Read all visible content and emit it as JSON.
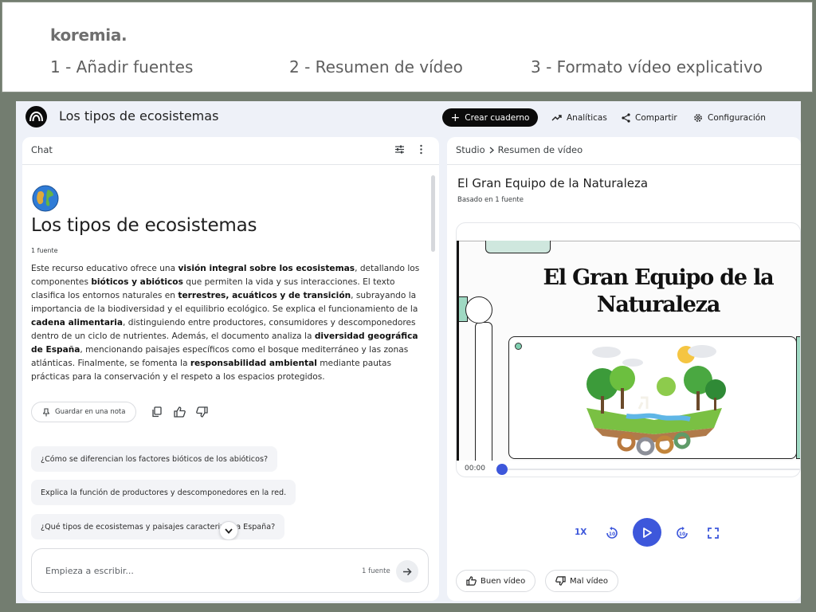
{
  "banner": {
    "brand": "koremia.",
    "steps": [
      "1 - Añadir fuentes",
      "2 - Resumen de vídeo",
      "3 - Formato vídeo explicativo"
    ]
  },
  "app": {
    "notebook_title": "Los tipos de ecosistemas",
    "toolbar": {
      "create": "Crear cuaderno",
      "analytics": "Analíticas",
      "share": "Compartir",
      "settings": "Configuración"
    },
    "icons": [
      "notebooklm-logo-icon",
      "plus-icon",
      "trending-up-icon",
      "share-icon",
      "gear-icon",
      "sliders-icon",
      "more-vert-icon",
      "globe-icon",
      "pin-icon",
      "copy-icon",
      "thumb-up-icon",
      "thumb-down-icon",
      "chevron-down-icon",
      "arrow-right-icon",
      "chevron-right-icon",
      "rewind-10-icon",
      "play-icon",
      "forward-10-icon",
      "fullscreen-icon"
    ]
  },
  "chat": {
    "label": "Chat",
    "title": "Los tipos de ecosistemas",
    "source_count": "1 fuente",
    "summary": [
      {
        "t": "Este recurso educativo ofrece una ",
        "b": false
      },
      {
        "t": "visión integral sobre los ecosistemas",
        "b": true
      },
      {
        "t": ", detallando los componentes ",
        "b": false
      },
      {
        "t": "bióticos y abióticos",
        "b": true
      },
      {
        "t": " que permiten la vida y sus interacciones. El texto clasifica los entornos naturales en ",
        "b": false
      },
      {
        "t": "terrestres, acuáticos y de transición",
        "b": true
      },
      {
        "t": ", subrayando la importancia de la biodiversidad y el equilibrio ecológico. Se explica el funcionamiento de la ",
        "b": false
      },
      {
        "t": "cadena alimentaria",
        "b": true
      },
      {
        "t": ", distinguiendo entre productores, consumidores y descomponedores dentro de un ciclo de nutrientes. Además, el documento analiza la ",
        "b": false
      },
      {
        "t": "diversidad geográfica de España",
        "b": true
      },
      {
        "t": ", mencionando paisajes específicos como el bosque mediterráneo y las zonas atlánticas. Finalmente, se fomenta la ",
        "b": false
      },
      {
        "t": "responsabilidad ambiental",
        "b": true
      },
      {
        "t": " mediante pautas prácticas para la conservación y el respeto a los espacios protegidos.",
        "b": false
      }
    ],
    "save_note": "Guardar en una nota",
    "suggestions": [
      "¿Cómo se diferencian los factores bióticos de los abióticos?",
      "Explica la función de productores y descomponedores en la red.",
      "¿Qué tipos de ecosistemas y paisajes caracterizan a España?"
    ],
    "composer_placeholder": "Empieza a escribir...",
    "composer_sources": "1 fuente"
  },
  "studio": {
    "crumb_root": "Studio",
    "crumb_current": "Resumen de vídeo",
    "video_title": "El Gran Equipo de la Naturaleza",
    "video_basis": "Basado en 1 fuente",
    "slide_title": "El Gran Equipo de la Naturaleza",
    "time": "00:00",
    "progress": 0,
    "speed": "1X",
    "good_video": "Buen vídeo",
    "bad_video": "Mal vídeo"
  },
  "colors": {
    "accent": "#3d57db",
    "mint": "#9fd9c3",
    "background": "#737d70",
    "panel_bg": "#eef1f8"
  }
}
